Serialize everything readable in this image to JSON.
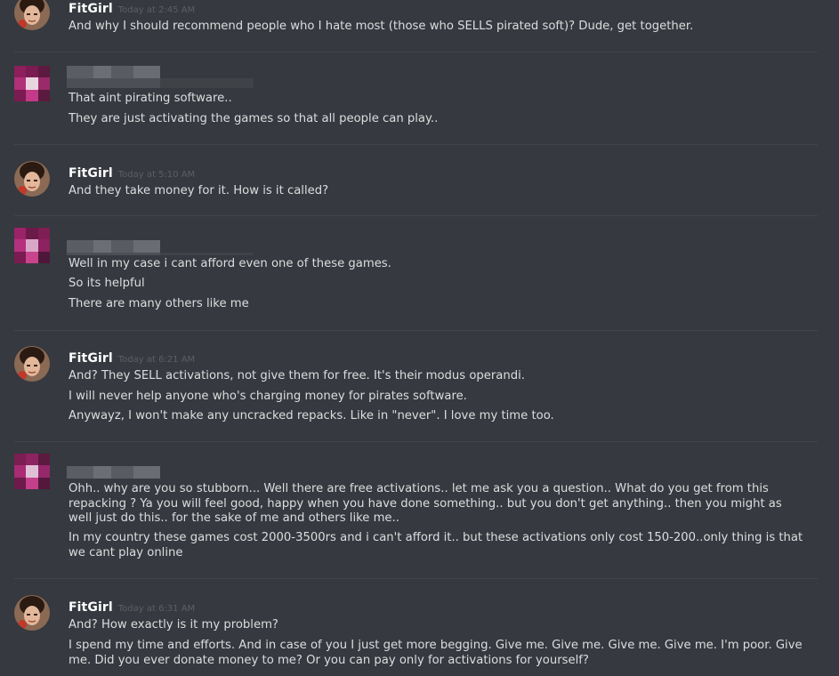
{
  "messages": [
    {
      "author": "FitGirl",
      "timestamp": "Today at 2:45 AM",
      "lines": [
        "And why I should recommend people who I hate most (those who SELLS pirated soft)? Dude, get together."
      ]
    },
    {
      "author": "",
      "timestamp": "",
      "lines": [
        "That aint pirating software..",
        "They are just activating the games so that all people can play.."
      ]
    },
    {
      "author": "FitGirl",
      "timestamp": "Today at 5:10 AM",
      "lines": [
        "And they take money for it. How is it called?"
      ]
    },
    {
      "author": "",
      "timestamp": "",
      "lines": [
        "Well in my case i cant afford even one of these games.",
        "So its helpful",
        "There are many others like me"
      ]
    },
    {
      "author": "FitGirl",
      "timestamp": "Today at 6:21 AM",
      "lines": [
        "And? They SELL activations, not give them for free. It's their modus operandi.",
        "I will never help anyone who's charging money for pirates software.",
        "Anywayz, I won't make any uncracked repacks. Like in \"never\". I love my time too."
      ]
    },
    {
      "author": "",
      "timestamp": "",
      "lines": [
        "Ohh.. why are you so stubborn... Well there are free activations.. let me ask you a question.. What do you get from this repacking ? Ya you will feel good, happy when you have done something.. but you don't get anything.. then you might as well just do this.. for the sake of me and others like me..",
        "In my country these games cost 2000-3500rs and i can't afford it.. but these activations only cost 150-200..only thing is that we cant play online"
      ]
    },
    {
      "author": "FitGirl",
      "timestamp": "Today at 6:31 AM",
      "lines": [
        "And? How exactly is it my problem?",
        "I spend my time and efforts. And in case of you I just get more begging. Give me. Give me. Give me. Give me. I'm poor. Give me. Did you ever donate money to me? Or you can pay only for activations for yourself?"
      ]
    }
  ]
}
